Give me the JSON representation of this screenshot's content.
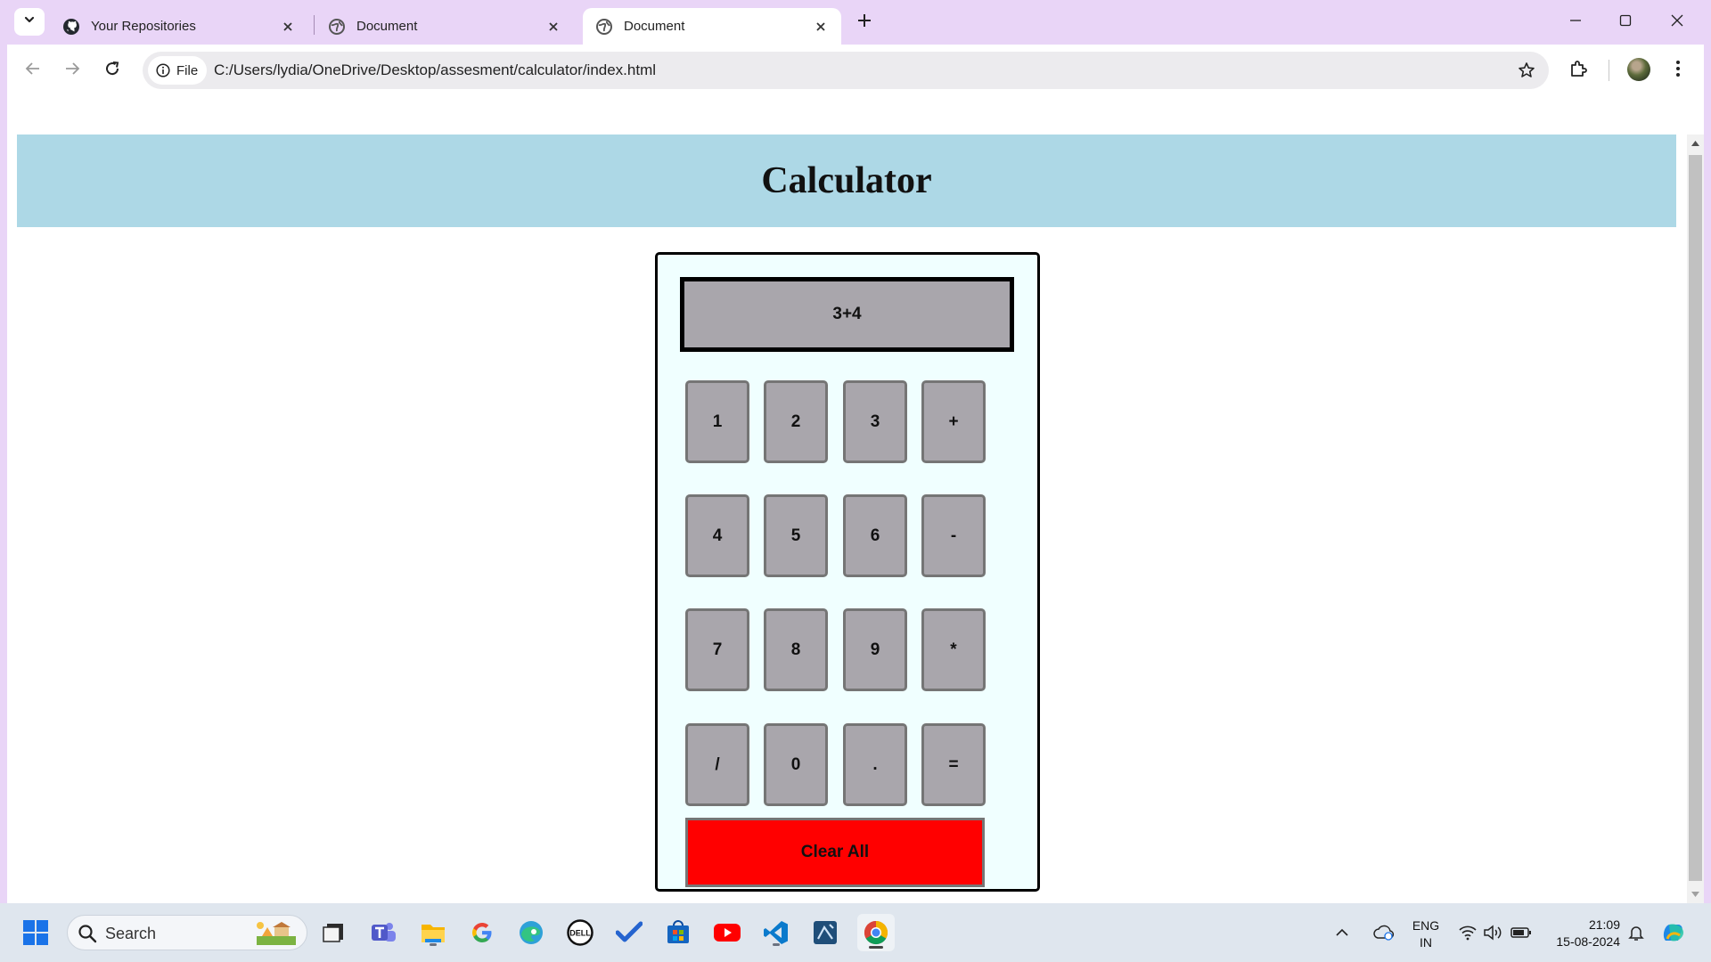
{
  "browser": {
    "tabs": [
      {
        "title": "Your Repositories",
        "icon": "github-icon",
        "active": false
      },
      {
        "title": "Document",
        "icon": "globe-icon",
        "active": false
      },
      {
        "title": "Document",
        "icon": "globe-icon",
        "active": true
      }
    ],
    "site_chip_label": "File",
    "url": "C:/Users/lydia/OneDrive/Desktop/assesment/calculator/index.html"
  },
  "page": {
    "title": "Calculator",
    "header_color": "#add8e6"
  },
  "calculator": {
    "display_value": "3+4",
    "keys": [
      [
        "1",
        "2",
        "3",
        "+"
      ],
      [
        "4",
        "5",
        "6",
        "-"
      ],
      [
        "7",
        "8",
        "9",
        "*"
      ],
      [
        "/",
        "0",
        ".",
        "="
      ]
    ],
    "clear_label": "Clear All",
    "clear_color": "#ff0000",
    "key_color": "#a9a6ac",
    "body_color": "#f0ffff"
  },
  "taskbar": {
    "search_label": "Search",
    "language": "ENG",
    "region": "IN",
    "time": "21:09",
    "date": "15-08-2024",
    "apps": [
      "windows-start-icon",
      "task-view-icon",
      "teams-icon",
      "file-explorer-icon",
      "google-icon",
      "edge-icon",
      "dell-icon",
      "todo-icon",
      "store-icon",
      "youtube-icon",
      "vscode-icon",
      "app-icon",
      "chrome-icon"
    ]
  }
}
